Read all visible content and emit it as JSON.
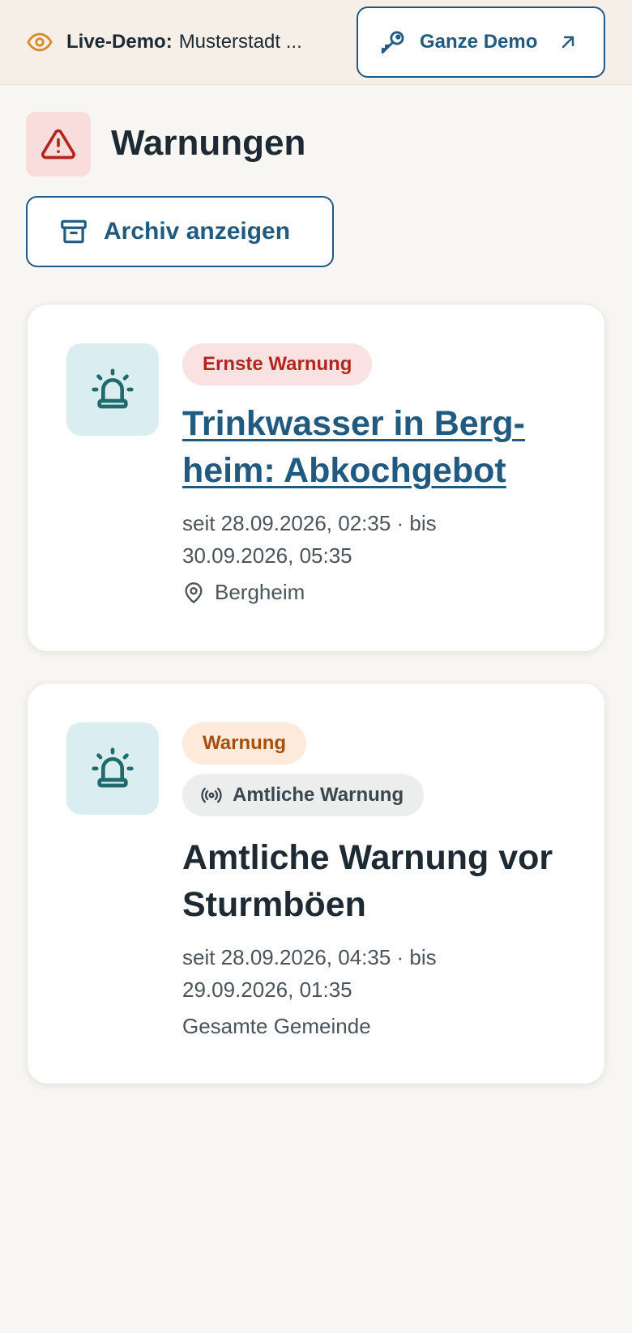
{
  "demo_bar": {
    "label_bold": "Live-Demo:",
    "label_text": "Musterstadt ...",
    "button_label": "Ganze Demo"
  },
  "page": {
    "title": "Warnungen",
    "archive_button": "Archiv anzeigen"
  },
  "warnings": [
    {
      "severity": "Ernste Warnung",
      "title": "Trinkwasser in Berg­heim: Abkochgebot",
      "period_line1": "seit 28.09.2026, 02:35 · bis",
      "period_line2": "30.09.2026, 05:35",
      "location": "Bergheim"
    },
    {
      "severity": "Warnung",
      "source_badge": "Amtliche Warnung",
      "title": "Amtliche Warnung vor Sturmböen",
      "period_line1": "seit 28.09.2026, 04:35 · bis",
      "period_line2": "29.09.2026, 01:35",
      "area": "Gesamte Gemeinde"
    }
  ],
  "icons": {
    "demo": "eye-icon",
    "demo_button": "key-icon",
    "demo_button_trailing": "arrow-up-right-icon",
    "page": "warning-triangle-icon",
    "archive": "archive-box-icon",
    "card": "siren-icon",
    "location": "map-pin-icon",
    "official": "broadcast-icon"
  },
  "colors": {
    "brand": "#215a80",
    "danger": "#b3261e",
    "warning": "#a64f0a",
    "background": "#f7f6f2",
    "demo_bar": "#f6efe7",
    "icon_teal": "#1f6b6e"
  }
}
